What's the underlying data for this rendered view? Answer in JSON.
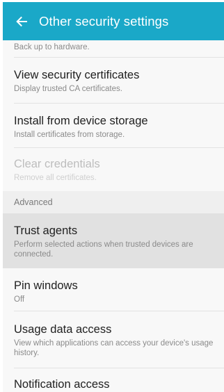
{
  "header": {
    "title": "Other security settings",
    "bg_color": "#1aa8c8"
  },
  "top_partial": {
    "subtitle": "Back up to hardware."
  },
  "items_group1": [
    {
      "title": "View security certificates",
      "subtitle": "Display trusted CA certificates."
    },
    {
      "title": "Install from device storage",
      "subtitle": "Install certificates from storage."
    },
    {
      "title": "Clear credentials",
      "subtitle": "Remove all certificates.",
      "disabled": true
    }
  ],
  "section": {
    "advanced": "Advanced"
  },
  "items_group2": [
    {
      "title": "Trust agents",
      "subtitle": "Perform selected actions when trusted devices are connected.",
      "highlighted": true
    },
    {
      "title": "Pin windows",
      "subtitle": "Off"
    },
    {
      "title": "Usage data access",
      "subtitle": "View which applications can access your device's usage history."
    },
    {
      "title": "Notification access"
    }
  ]
}
